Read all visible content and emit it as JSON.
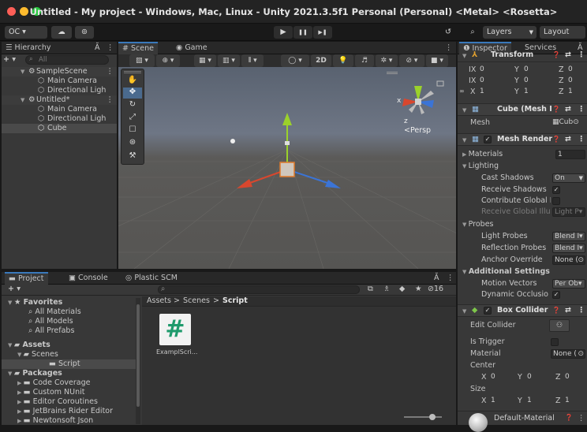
{
  "window": {
    "title": "Untitled - My project - Windows, Mac, Linux - Unity 2021.3.5f1 Personal (Personal) <Metal> <Rosetta>"
  },
  "toolbar": {
    "account": "OC ▾",
    "cloud": "☁",
    "collab": "⊚",
    "play": "▶",
    "pause": "❚❚",
    "step": "▶❚",
    "history": "↺",
    "search": "⌕",
    "layers": "Layers",
    "layout": "Layout"
  },
  "hierarchy": {
    "tab": "Hierarchy",
    "search_placeholder": "All",
    "add": "+ ▾",
    "lock": "Ă",
    "menu": "⋮",
    "items": [
      {
        "label": "SampleScene",
        "menu": "⋮"
      },
      {
        "label": "Main Camera"
      },
      {
        "label": "Directional Ligh"
      },
      {
        "label": "Untitled*",
        "menu": "⋮"
      },
      {
        "label": "Main Camera"
      },
      {
        "label": "Directional Ligh"
      },
      {
        "label": "Cube"
      }
    ]
  },
  "scene": {
    "tabs": [
      {
        "label": "Scene"
      },
      {
        "label": "Game"
      }
    ],
    "menu": "⋮",
    "toggle_2d": "2D",
    "gizmo_labels": {
      "x": "x",
      "y": "y",
      "z": "z",
      "persp": "<Persp"
    },
    "tools": [
      "✋",
      "✥",
      "↻",
      "⤢",
      "☐",
      "⊛",
      "⚒"
    ]
  },
  "project": {
    "tabs": [
      {
        "label": "Project"
      },
      {
        "label": "Console"
      },
      {
        "label": "Plastic SCM"
      }
    ],
    "add": "+ ▾",
    "search_icon": "⌕",
    "lock": "Ă",
    "menu": "⋮",
    "hidden_count": "16",
    "favorites": {
      "label": "Favorites",
      "items": [
        "All Materials",
        "All Models",
        "All Prefabs"
      ]
    },
    "assets": {
      "label": "Assets",
      "items": [
        {
          "label": "Scenes"
        },
        {
          "label": "Script"
        }
      ]
    },
    "packages": {
      "label": "Packages",
      "items": [
        "Code Coverage",
        "Custom NUnit",
        "Editor Coroutines",
        "JetBrains Rider Editor",
        "Newtonsoft Json"
      ]
    },
    "breadcrumb": {
      "parts": [
        "Assets",
        "Scenes",
        "Script"
      ],
      "sep": ">"
    },
    "files": [
      {
        "name": "ExamplScri...",
        "glyph": "#"
      }
    ]
  },
  "inspector": {
    "tabs": [
      {
        "label": "Inspector"
      },
      {
        "label": "Services"
      }
    ],
    "lock": "Ă",
    "transform": {
      "title": "Transform",
      "position": {
        "x": "0",
        "y": "0",
        "z": "0"
      },
      "rotation": {
        "x": "0",
        "y": "0",
        "z": "0"
      },
      "scale": {
        "x": "1",
        "y": "1",
        "z": "1"
      }
    },
    "mesh_filter": {
      "title": "Cube (Mesh I",
      "mesh_label": "Mesh",
      "mesh_value": "Cub"
    },
    "mesh_renderer": {
      "title": "Mesh Render",
      "materials_label": "Materials",
      "materials_count": "1",
      "lighting_label": "Lighting",
      "cast_shadows_label": "Cast Shadows",
      "cast_shadows_value": "On",
      "receive_shadows_label": "Receive Shadows",
      "receive_shadows_check": "✓",
      "contribute_gi_label": "Contribute Global I",
      "receive_gi_label": "Receive Global Illu",
      "receive_gi_value": "Light P▾",
      "probes_label": "Probes",
      "light_probes_label": "Light Probes",
      "light_probes_value": "Blend I▾",
      "reflection_probes_label": "Reflection Probes",
      "reflection_probes_value": "Blend I▾",
      "anchor_override_label": "Anchor Override",
      "anchor_override_value": "None (",
      "additional_settings_label": "Additional Settings",
      "motion_vectors_label": "Motion Vectors",
      "motion_vectors_value": "Per Ob▾",
      "dynamic_occlusion_label": "Dynamic Occlusio",
      "dynamic_occlusion_check": "✓"
    },
    "box_collider": {
      "title": "Box Collider",
      "edit_collider_label": "Edit Collider",
      "is_trigger_label": "Is Trigger",
      "material_label": "Material",
      "material_value": "None (",
      "center_label": "Center",
      "center": {
        "x": "0",
        "y": "0",
        "z": "0"
      },
      "size_label": "Size",
      "size": {
        "x": "1",
        "y": "1",
        "z": "1"
      }
    },
    "material": {
      "title": "Default-Material"
    },
    "header_icons": {
      "help": "❓",
      "preset": "⇄",
      "menu": "⋮"
    },
    "axis": {
      "x": "X",
      "y": "Y",
      "z": "Z"
    }
  },
  "colors": {
    "accent": "#3a79bb",
    "selection": "#2c5d87",
    "x_axis": "#d8472e",
    "y_axis": "#9bd12b",
    "z_axis": "#3b74d6"
  }
}
